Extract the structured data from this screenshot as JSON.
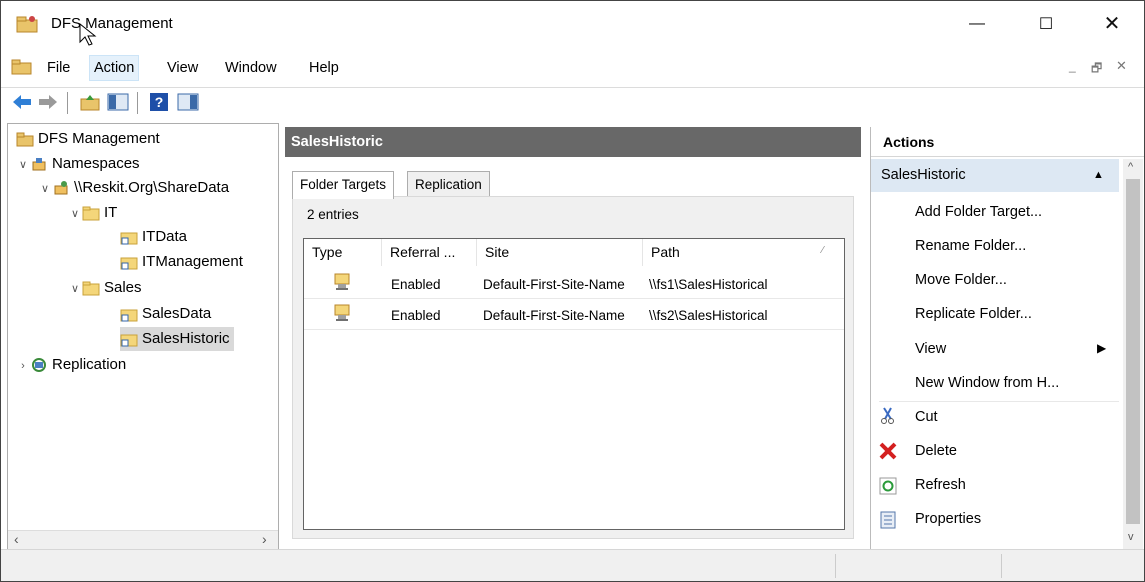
{
  "window": {
    "title": "DFS Management"
  },
  "menu": [
    "File",
    "Action",
    "View",
    "Window",
    "Help"
  ],
  "tree": {
    "root": "DFS Management",
    "namespaces": "Namespaces",
    "share": "\\\\Reskit.Org\\ShareData",
    "it": "IT",
    "itdata": "ITData",
    "itmgmt": "ITManagement",
    "sales": "Sales",
    "salesdata": "SalesData",
    "saleshistoric": "SalesHistoric",
    "replication": "Replication"
  },
  "center": {
    "title": "SalesHistoric",
    "tabs": [
      "Folder Targets",
      "Replication"
    ],
    "count": "2 entries",
    "columns": [
      "Type",
      "Referral ...",
      "Site",
      "Path"
    ],
    "rows": [
      {
        "referral": "Enabled",
        "site": "Default-First-Site-Name",
        "path": "\\\\fs1\\SalesHistorical"
      },
      {
        "referral": "Enabled",
        "site": "Default-First-Site-Name",
        "path": "\\\\fs2\\SalesHistorical"
      }
    ]
  },
  "actions": {
    "title": "Actions",
    "section": "SalesHistoric",
    "items": [
      "Add Folder Target...",
      "Rename Folder...",
      "Move Folder...",
      "Replicate Folder...",
      "View",
      "New Window from H...",
      "Cut",
      "Delete",
      "Refresh",
      "Properties"
    ]
  }
}
